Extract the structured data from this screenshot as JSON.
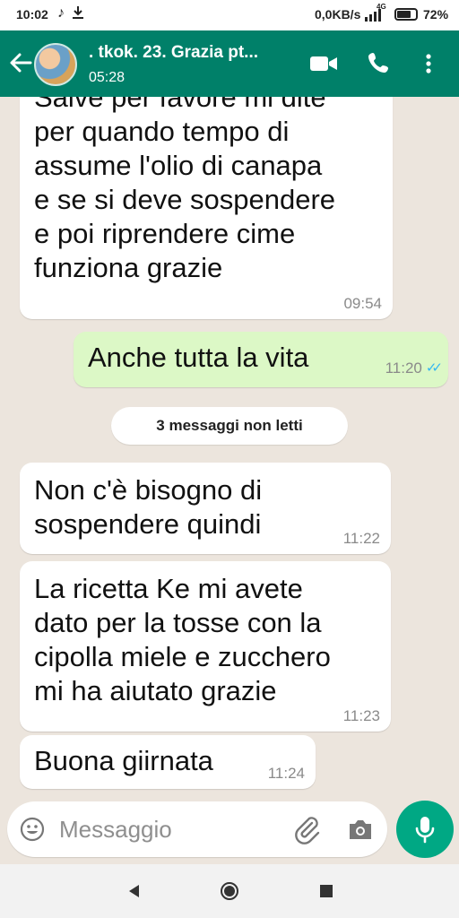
{
  "status_bar": {
    "time": "10:02",
    "network_speed": "0,0KB/s",
    "network_type": "4G",
    "battery": "72%",
    "icons": [
      "tiktok-icon",
      "download-icon",
      "signal-icon",
      "battery-icon"
    ]
  },
  "header": {
    "title": ". tkok. 23. Grazia pt...",
    "subtitle": "05:28",
    "icons": [
      "back-arrow-icon",
      "video-call-icon",
      "phone-icon",
      "more-vert-icon"
    ],
    "color": "#008069"
  },
  "messages": [
    {
      "direction": "in",
      "lines": [
        "Salve per favore mi dite",
        "per quando tempo di",
        "assume l'olio di canapa",
        "e se si deve sospendere",
        "e poi riprendere cime",
        "funziona grazie"
      ],
      "time": "09:54"
    },
    {
      "direction": "out",
      "lines": [
        "Anche tutta la vita"
      ],
      "time": "11:20",
      "status": "read"
    },
    {
      "direction": "in",
      "lines": [
        "Non c'è bisogno di",
        "sospendere quindi"
      ],
      "time": "11:22"
    },
    {
      "direction": "in",
      "lines": [
        "La ricetta Ke mi avete",
        "dato per la tosse con la",
        "cipolla miele e zucchero",
        "mi ha aiutato grazie"
      ],
      "time": "11:23"
    },
    {
      "direction": "in",
      "lines": [
        "Buona giirnata"
      ],
      "time": "11:24"
    }
  ],
  "unread_divider": "3 messaggi non letti",
  "composer": {
    "placeholder": "Messaggio",
    "value": "",
    "icons": [
      "emoji-icon",
      "attach-icon",
      "camera-icon",
      "mic-icon"
    ]
  },
  "colors": {
    "chat_background": "#ece5dd",
    "incoming_bubble": "#ffffff",
    "outgoing_bubble": "#dcf8c6",
    "accent": "#00a884",
    "read_ticks": "#34b7f1"
  },
  "nav_bar": {
    "icons": [
      "back-triangle-icon",
      "home-circle-icon",
      "recents-square-icon"
    ]
  }
}
